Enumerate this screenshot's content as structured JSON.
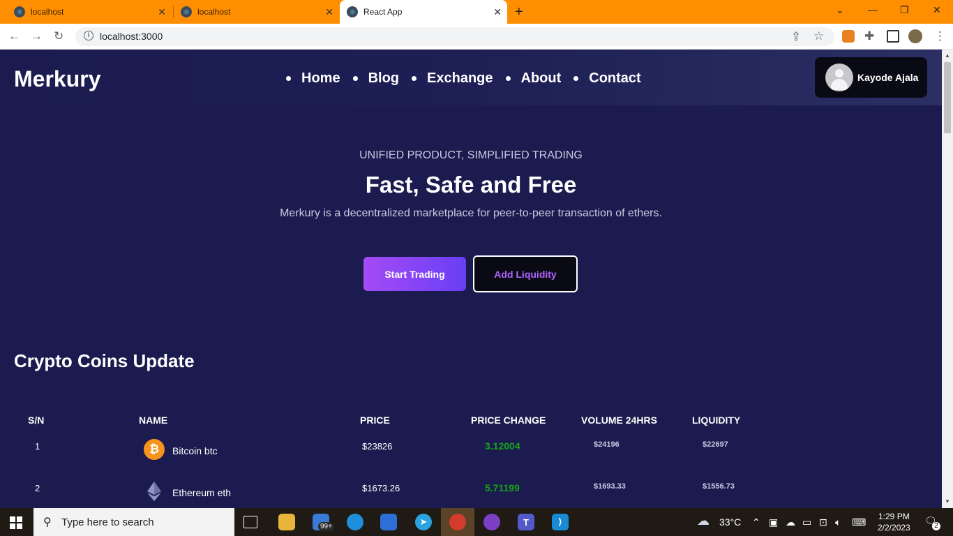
{
  "browser": {
    "tabs": [
      {
        "title": "localhost",
        "active": false
      },
      {
        "title": "localhost",
        "active": false
      },
      {
        "title": "React App",
        "active": true
      }
    ],
    "url": "localhost:3000"
  },
  "navbar": {
    "brand": "Merkury",
    "links": [
      "Home",
      "Blog",
      "Exchange",
      "About",
      "Contact"
    ],
    "user_name": "Kayode Ajala"
  },
  "hero": {
    "kicker": "UNIFIED PRODUCT, SIMPLIFIED TRADING",
    "title": "Fast, Safe and Free",
    "subtitle": "Merkury is a decentralized marketplace for peer-to-peer transaction of ethers.",
    "primary_button": "Start Trading",
    "secondary_button": "Add Liquidity"
  },
  "coins": {
    "section_title": "Crypto Coins Update",
    "headers": [
      "S/N",
      "NAME",
      "PRICE",
      "PRICE CHANGE",
      "VOLUME 24HRS",
      "LIQUIDITY"
    ],
    "rows": [
      {
        "sn": "1",
        "name": "Bitcoin btc",
        "icon": "bitcoin-icon",
        "price": "$23826",
        "change": "3.12004",
        "volume": "$24196",
        "liquidity": "$22697"
      },
      {
        "sn": "2",
        "name": "Ethereum eth",
        "icon": "ethereum-icon",
        "price": "$1673.26",
        "change": "5.71199",
        "volume": "$1693.33",
        "liquidity": "$1556.73"
      }
    ],
    "colors": {
      "positive": "#16a516"
    }
  },
  "taskbar": {
    "search_placeholder": "Type here to search",
    "mail_badge": "99+",
    "weather": "33°C",
    "time": "1:29 PM",
    "date": "2/2/2023",
    "notifications": "2"
  },
  "theme": {
    "background": "#1b1b4f",
    "accent": "#a44bf6",
    "tabstrip": "#ff8f00"
  }
}
